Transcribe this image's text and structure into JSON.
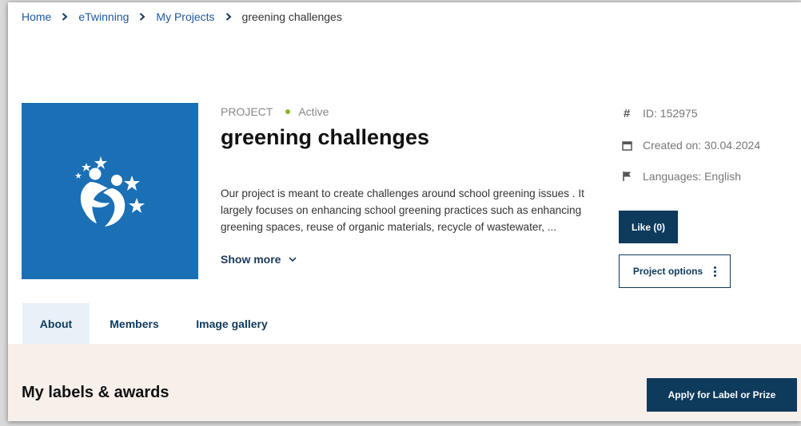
{
  "breadcrumb": {
    "items": [
      "Home",
      "eTwinning",
      "My Projects"
    ],
    "current": "greening challenges"
  },
  "project": {
    "type_label": "PROJECT",
    "status": "Active",
    "title": "greening challenges",
    "description": "Our project is meant to create challenges around school greening issues . It largely focuses on enhancing school greening practices such as enhancing greening spaces, reuse of organic materials, recycle of wastewater, ...",
    "show_more": "Show more"
  },
  "info": {
    "id": "ID: 152975",
    "created": "Created on: 30.04.2024",
    "languages": "Languages: English"
  },
  "actions": {
    "like": "Like (0)",
    "options": "Project options"
  },
  "tabs": [
    "About",
    "Members",
    "Image gallery"
  ],
  "awards": {
    "title": "My labels & awards",
    "apply_button": "Apply for Label or Prize"
  },
  "colors": {
    "hero_bg": "#1a6fb5",
    "primary": "#0e3a5c",
    "status_dot": "#8ab622",
    "awards_bg": "#f7efea"
  }
}
